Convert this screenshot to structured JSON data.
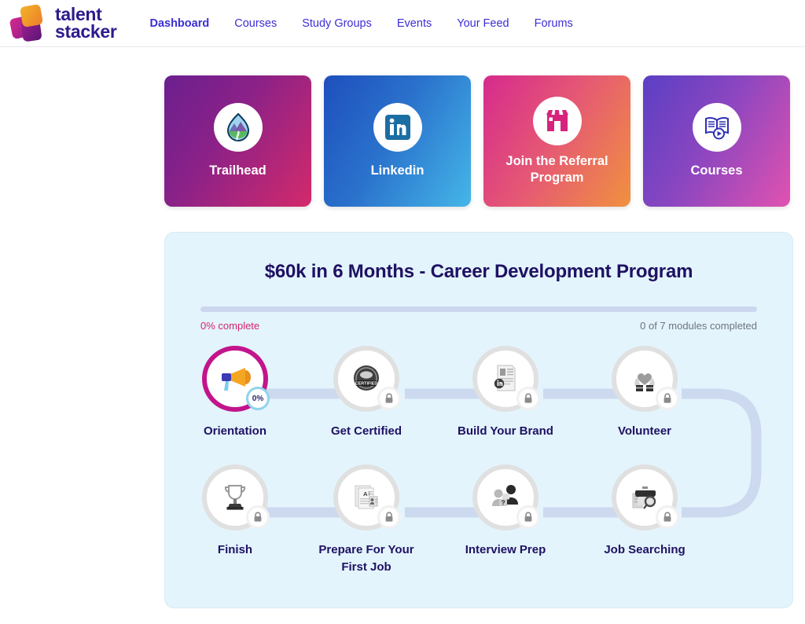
{
  "brand": {
    "name_line1": "talent",
    "name_line2": "stacker",
    "logo_icon": "stacked-squares-logo",
    "color_primary": "#2c1b8c",
    "color_accent_orange": "#f5a623",
    "color_accent_magenta": "#b4227e"
  },
  "nav": {
    "items": [
      {
        "label": "Dashboard",
        "active": true
      },
      {
        "label": "Courses",
        "active": false
      },
      {
        "label": "Study Groups",
        "active": false
      },
      {
        "label": "Events",
        "active": false
      },
      {
        "label": "Your Feed",
        "active": false
      },
      {
        "label": "Forums",
        "active": false
      }
    ],
    "link_color": "#3b2fd4"
  },
  "quick_cards": [
    {
      "label": "Trailhead",
      "icon": "trailhead-mountain-icon",
      "gradient_from": "#6b1f8f",
      "gradient_to": "#d32a6a"
    },
    {
      "label": "Linkedin",
      "icon": "linkedin-icon",
      "gradient_from": "#1e4fbd",
      "gradient_to": "#45b6e8"
    },
    {
      "label": "Join the Referral Program",
      "icon": "storefront-icon",
      "gradient_from": "#d62a8e",
      "gradient_to": "#f0913f"
    },
    {
      "label": "Courses",
      "icon": "book-play-icon",
      "gradient_from": "#5b3fc4",
      "gradient_to": "#e152b0"
    }
  ],
  "program": {
    "title": "$60k in 6 Months - Career Development Program",
    "progress_percent": 0,
    "progress_label": "0% complete",
    "modules_completed_label": "0 of 7 modules completed",
    "panel_background": "#e3f4fc",
    "percent_text_color": "#d6246e",
    "modules_text_color": "#6f7384",
    "modules": [
      {
        "label": "Orientation",
        "icon": "megaphone-icon",
        "state": "active",
        "badge": "0%",
        "ring_color": "#c2158c"
      },
      {
        "label": "Get Certified",
        "icon": "certified-seal-icon",
        "state": "locked",
        "badge": "lock-icon",
        "ring_color": "#e0e0e0"
      },
      {
        "label": "Build Your Brand",
        "icon": "resume-linkedin-icon",
        "state": "locked",
        "badge": "lock-icon",
        "ring_color": "#e0e0e0"
      },
      {
        "label": "Volunteer",
        "icon": "heart-in-hands-icon",
        "state": "locked",
        "badge": "lock-icon",
        "ring_color": "#e0e0e0"
      },
      {
        "label": "Job Searching",
        "icon": "briefcase-search-icon",
        "state": "locked",
        "badge": "lock-icon",
        "ring_color": "#e0e0e0"
      },
      {
        "label": "Interview Prep",
        "icon": "interview-people-icon",
        "state": "locked",
        "badge": "lock-icon",
        "ring_color": "#e0e0e0"
      },
      {
        "label": "Prepare For Your First Job",
        "icon": "documents-grade-icon",
        "state": "locked",
        "badge": "lock-icon",
        "ring_color": "#e0e0e0"
      },
      {
        "label": "Finish",
        "icon": "trophy-icon",
        "state": "locked",
        "badge": "lock-icon",
        "ring_color": "#e0e0e0"
      }
    ]
  }
}
